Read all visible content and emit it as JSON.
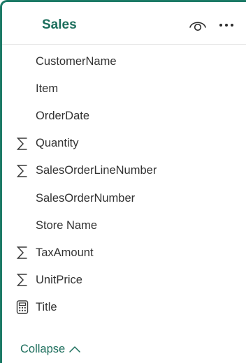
{
  "table": {
    "title": "Sales",
    "header_icons": [
      "eye-icon",
      "more-icon"
    ]
  },
  "fields": [
    {
      "label": "CustomerName",
      "icon": ""
    },
    {
      "label": "Item",
      "icon": ""
    },
    {
      "label": "OrderDate",
      "icon": ""
    },
    {
      "label": "Quantity",
      "icon": "sigma-icon"
    },
    {
      "label": "SalesOrderLineNumber",
      "icon": "sigma-icon"
    },
    {
      "label": "SalesOrderNumber",
      "icon": ""
    },
    {
      "label": "Store Name",
      "icon": ""
    },
    {
      "label": "TaxAmount",
      "icon": "sigma-icon"
    },
    {
      "label": "UnitPrice",
      "icon": "sigma-icon"
    },
    {
      "label": "Title",
      "icon": "calculator-icon"
    }
  ],
  "collapse": {
    "label": "Collapse",
    "icon": "chevron-up-icon"
  },
  "colors": {
    "accent": "#1c7a66",
    "title": "#1c6e5c",
    "text": "#323232"
  }
}
